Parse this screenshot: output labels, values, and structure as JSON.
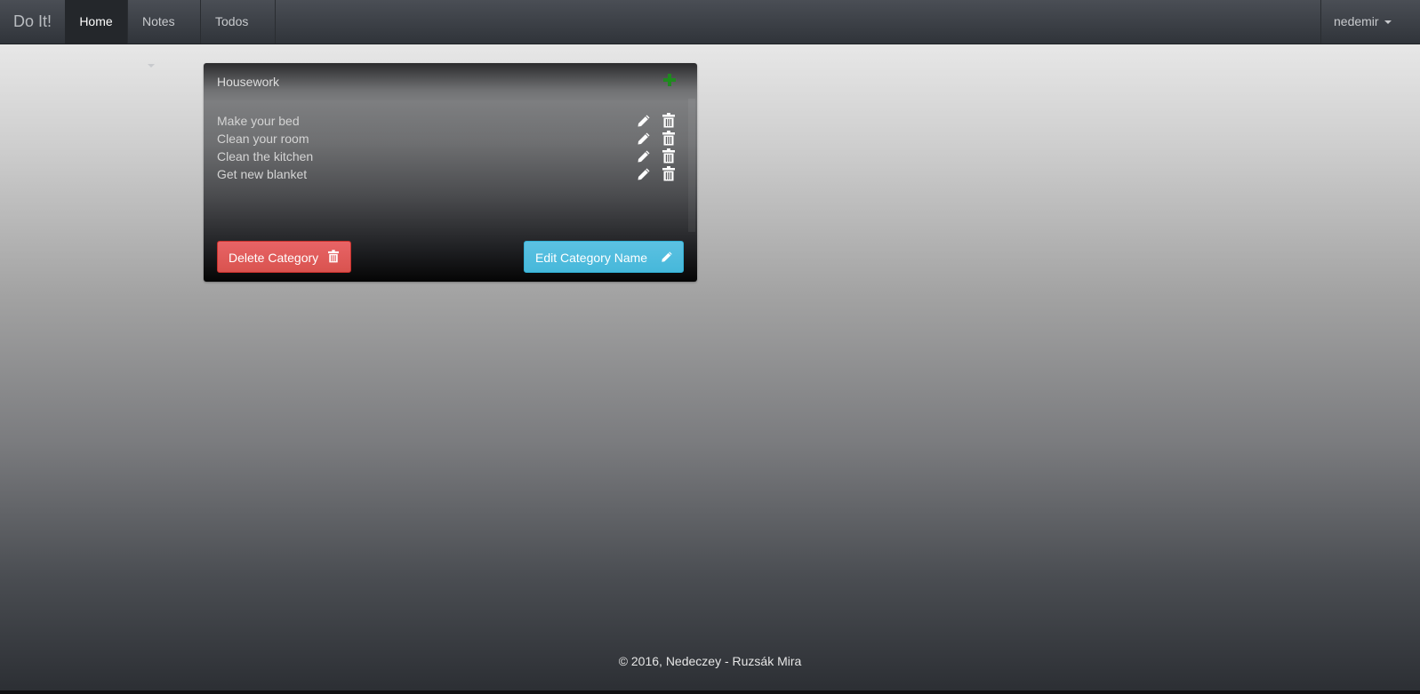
{
  "navbar": {
    "brand": "Do It!",
    "items": [
      {
        "label": "Home"
      },
      {
        "label": "Notes"
      },
      {
        "label": "Todos"
      }
    ],
    "user": "nedemir"
  },
  "panel": {
    "title": "Housework",
    "todos": [
      {
        "text": "Make your bed"
      },
      {
        "text": "Clean your room"
      },
      {
        "text": "Clean the kitchen"
      },
      {
        "text": "Get new blanket"
      }
    ],
    "delete_label": "Delete Category",
    "edit_label": "Edit Category Name"
  },
  "footer": {
    "text": "© 2016, Nedeczey - Ruzsák Mira"
  },
  "colors": {
    "add_icon": "#1f8a1f",
    "danger": "#d9534f",
    "info": "#46b8da"
  },
  "icons": {
    "add": "plus-icon",
    "edit": "pencil-icon",
    "delete": "trash-icon"
  }
}
